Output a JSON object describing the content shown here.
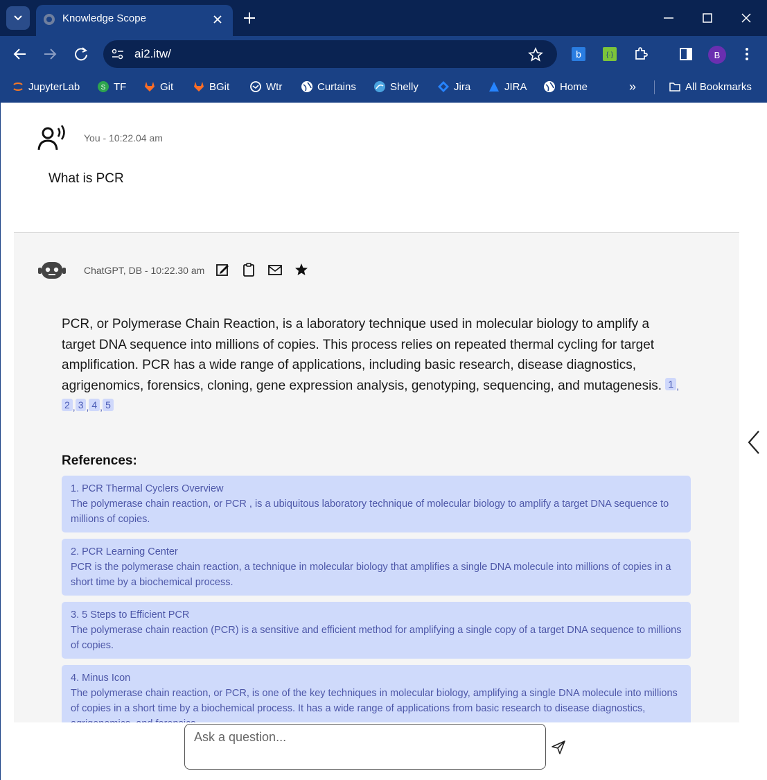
{
  "browser": {
    "tab_title": "Knowledge Scope",
    "url": "ai2.itw/",
    "profile_initial": "B",
    "bookmarks": [
      {
        "label": "JupyterLab",
        "icon": "jupyter-icon"
      },
      {
        "label": "TF",
        "icon": "tf-icon"
      },
      {
        "label": "Git",
        "icon": "gitlab-icon"
      },
      {
        "label": "BGit",
        "icon": "gitlab-icon"
      },
      {
        "label": "Wtr",
        "icon": "wtr-icon"
      },
      {
        "label": "Curtains",
        "icon": "globe-icon"
      },
      {
        "label": "Shelly",
        "icon": "shelly-icon"
      },
      {
        "label": "Jira",
        "icon": "jira-icon"
      },
      {
        "label": "JIRA",
        "icon": "jira-icon"
      },
      {
        "label": "Home",
        "icon": "globe-icon"
      }
    ],
    "more_bookmarks": "»",
    "all_bookmarks": "All Bookmarks"
  },
  "chat": {
    "user_meta": "You - 10:22.04 am",
    "user_question": "What is PCR",
    "bot_meta": "ChatGPT, DB - 10:22.30 am",
    "answer": "PCR, or Polymerase Chain Reaction, is a laboratory technique used in molecular biology to amplify a target DNA sequence into millions of copies. This process relies on repeated thermal cycling for target amplification. PCR has a wide range of applications, including basic research, disease diagnostics, agrigenomics, forensics, cloning, gene expression analysis, genotyping, sequencing, and mutagenesis.",
    "citations": [
      "1",
      "2",
      "3",
      "4",
      "5"
    ],
    "references_heading": "References:",
    "references": [
      {
        "title": "1. PCR Thermal Cyclers Overview",
        "text": "The polymerase chain reaction, or PCR , is a ubiquitous laboratory technique of molecular biology to amplify a target DNA sequence to millions of copies."
      },
      {
        "title": "2. PCR Learning Center",
        "text": "PCR is the polymerase chain reaction, a technique in molecular biology that amplifies a single DNA molecule into millions of copies in a short time by a biochemical process."
      },
      {
        "title": "3. 5 Steps to Efficient PCR",
        "text": "The polymerase chain reaction (PCR) is a sensitive and efficient method for amplifying a single copy of a target DNA sequence to millions of copies."
      },
      {
        "title": "4. Minus Icon",
        "text": "The polymerase chain reaction, or PCR, is one of the key techniques in molecular biology, amplifying a single DNA molecule into millions of copies in a short time by a biochemical process. It has a wide range of applications from basic research to disease diagnostics, agrigenomics, and forensics."
      }
    ]
  },
  "input": {
    "placeholder": "Ask a question..."
  }
}
